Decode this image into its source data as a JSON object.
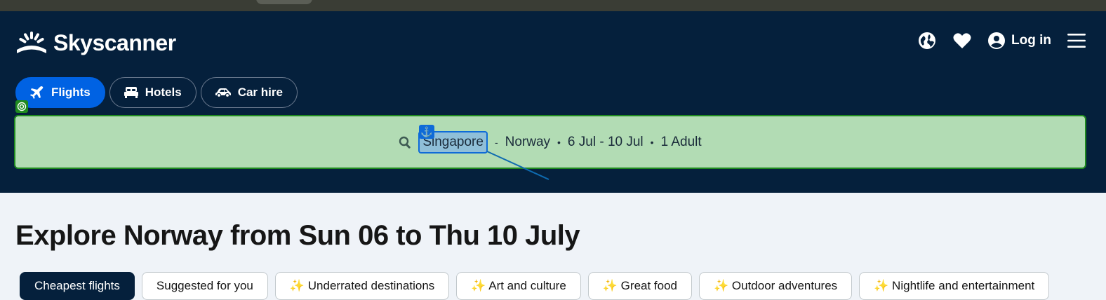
{
  "brand": {
    "name": "Skyscanner"
  },
  "header": {
    "login_label": "Log in",
    "icons": [
      "globe-icon",
      "heart-icon",
      "account-icon",
      "menu-icon"
    ]
  },
  "tabs": [
    {
      "label": "Flights",
      "icon": "plane-icon",
      "active": true
    },
    {
      "label": "Hotels",
      "icon": "bed-icon",
      "active": false
    },
    {
      "label": "Car hire",
      "icon": "car-icon",
      "active": false
    }
  ],
  "search": {
    "origin": "Singapore",
    "separator_route": "-",
    "destination": "Norway",
    "dates": "6 Jul - 10 Jul",
    "travellers": "1 Adult",
    "dot": "•"
  },
  "page": {
    "title": "Explore Norway from Sun 06 to Thu 10 July"
  },
  "chips": [
    {
      "label": "Cheapest flights",
      "active": true
    },
    {
      "label": "Suggested for you",
      "active": false
    },
    {
      "label": "✨ Underrated destinations",
      "active": false
    },
    {
      "label": "✨ Art and culture",
      "active": false
    },
    {
      "label": "✨ Great food",
      "active": false
    },
    {
      "label": "✨ Outdoor adventures",
      "active": false
    },
    {
      "label": "✨ Nightlife and entertainment",
      "active": false
    }
  ],
  "colors": {
    "navy": "#05203c",
    "accent_blue": "#0062e3",
    "highlight_green": "#b2dcb4"
  }
}
